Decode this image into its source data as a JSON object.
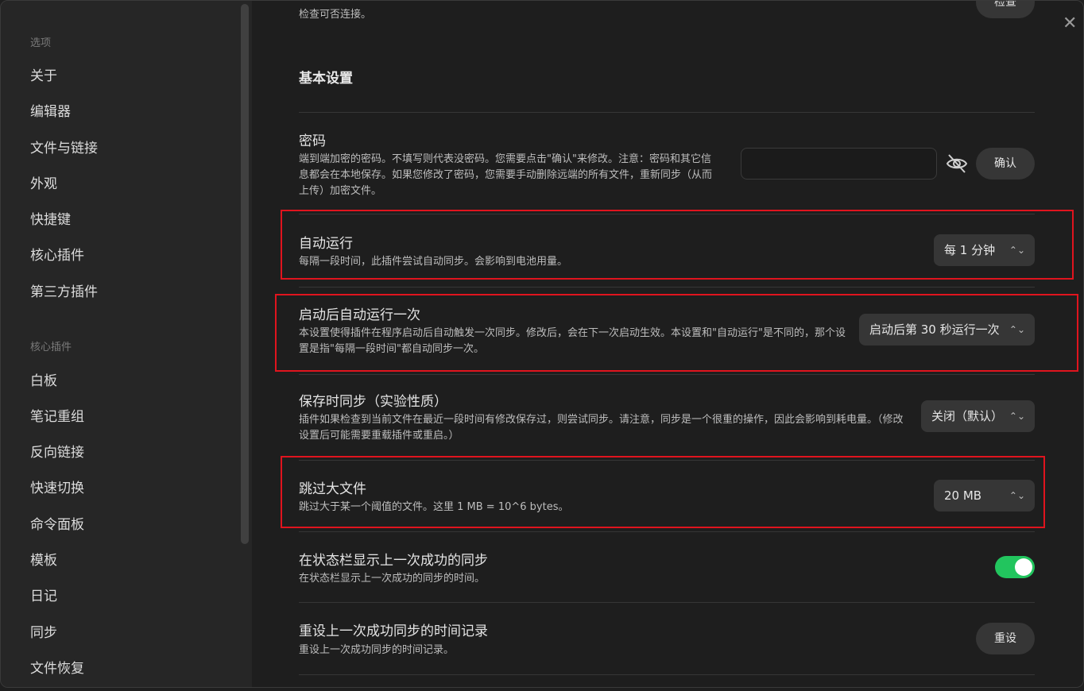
{
  "sidebar": {
    "heading_options": "选项",
    "options": [
      "关于",
      "编辑器",
      "文件与链接",
      "外观",
      "快捷键",
      "核心插件",
      "第三方插件"
    ],
    "heading_core": "核心插件",
    "core_plugins": [
      "白板",
      "笔记重组",
      "反向链接",
      "快速切换",
      "命令面板",
      "模板",
      "日记",
      "同步",
      "文件恢复"
    ]
  },
  "top": {
    "check_desc": "检查可否连接。",
    "check_button": "检查"
  },
  "section_title": "基本设置",
  "password": {
    "name": "密码",
    "desc": "端到端加密的密码。不填写则代表没密码。您需要点击\"确认\"来修改。注意：密码和其它信息都会在本地保存。如果您修改了密码，您需要手动删除远端的所有文件，重新同步（从而上传）加密文件。",
    "value": "",
    "confirm_button": "确认",
    "eye_icon": "eye-off-icon"
  },
  "auto_run": {
    "name": "自动运行",
    "desc": "每隔一段时间，此插件尝试自动同步。会影响到电池用量。",
    "value": "每 1 分钟"
  },
  "run_once": {
    "name": "启动后自动运行一次",
    "desc": "本设置使得插件在程序启动后自动触发一次同步。修改后，会在下一次启动生效。本设置和\"自动运行\"是不同的，那个设置是指\"每隔一段时间\"都自动同步一次。",
    "value": "启动后第 30 秒运行一次"
  },
  "save_sync": {
    "name": "保存时同步（实验性质）",
    "desc": "插件如果检查到当前文件在最近一段时间有修改保存过，则尝试同步。请注意，同步是一个很重的操作，因此会影响到耗电量。（修改设置后可能需要重载插件或重启。）",
    "value": "关闭（默认）"
  },
  "skip_large": {
    "name": "跳过大文件",
    "desc": "跳过大于某一个阈值的文件。这里 1 MB = 10^6 bytes。",
    "value": "20 MB"
  },
  "status_bar": {
    "name": "在状态栏显示上一次成功的同步",
    "desc": "在状态栏显示上一次成功的同步的时间。",
    "enabled": true
  },
  "reset": {
    "name": "重设上一次成功同步的时间记录",
    "desc": "重设上一次成功同步的时间记录。",
    "button": "重设"
  },
  "colors": {
    "accent_toggle": "#22c55e",
    "highlight": "#e0141e"
  },
  "icons": {
    "close": "close-icon",
    "chevron": "chevron-updown-icon"
  }
}
